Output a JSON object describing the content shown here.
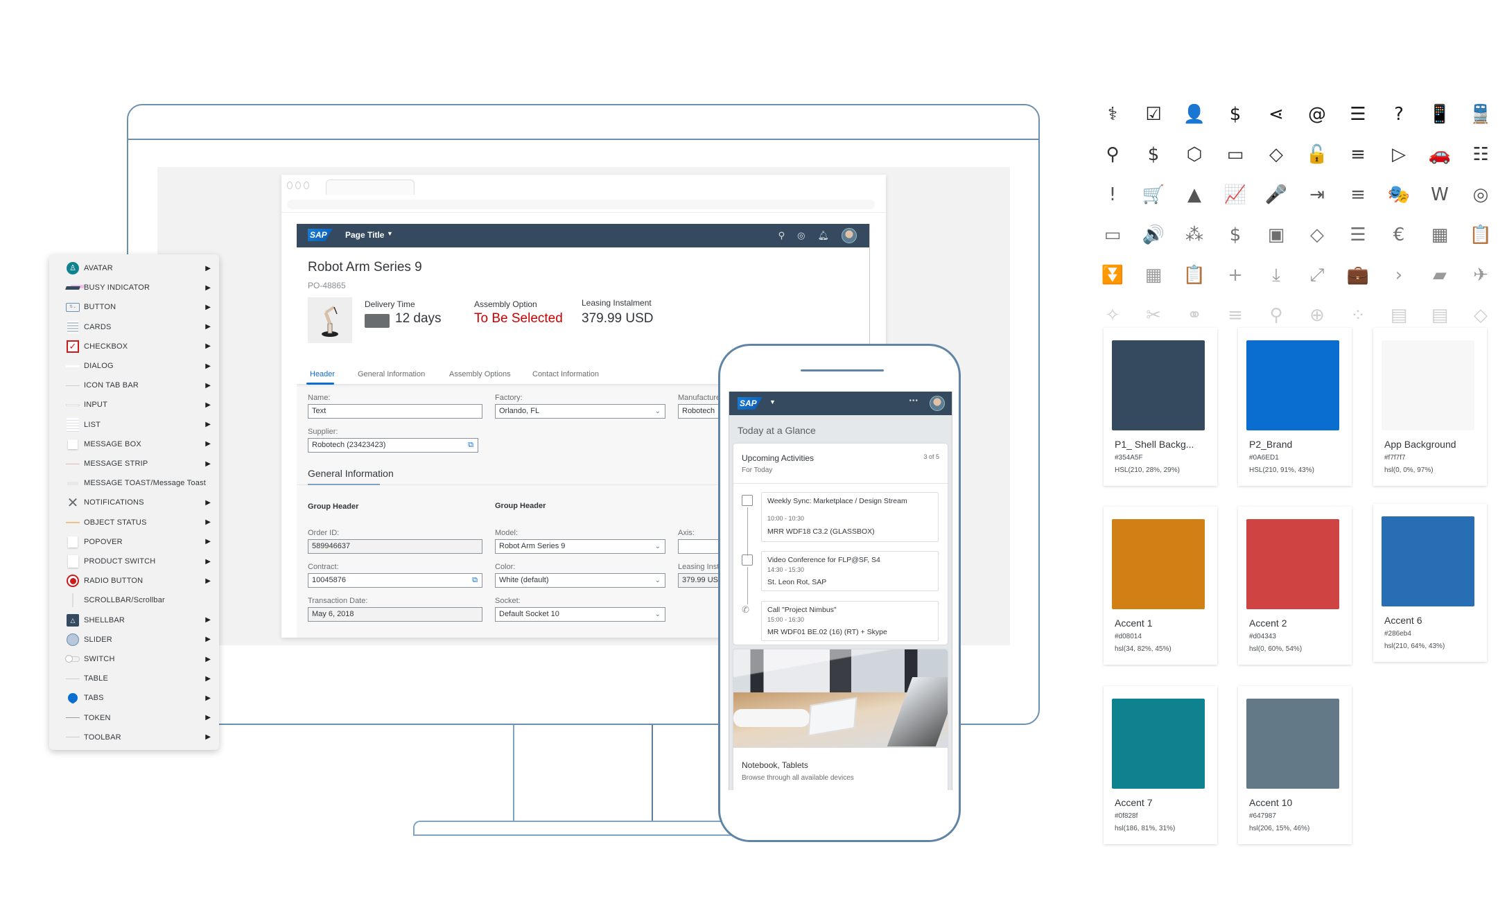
{
  "desktop_app": {
    "shellbar": {
      "logo": "SAP",
      "page_title": "Page Title"
    },
    "object": {
      "title": "Robot Arm Series 9",
      "subtitle": "PO-48865",
      "kpis": [
        {
          "label": "Delivery Time",
          "value": "12 days"
        },
        {
          "label": "Assembly Option",
          "value": "To Be Selected"
        },
        {
          "label": "Leasing Instalment",
          "value": "379.99 USD"
        }
      ]
    },
    "tabs": [
      "Header",
      "General Information",
      "Assembly Options",
      "Contact Information"
    ],
    "header_form": {
      "name": {
        "label": "Name:",
        "value": "Text"
      },
      "factory": {
        "label": "Factory:",
        "value": "Orlando, FL"
      },
      "manufacturer": {
        "label": "Manufacture",
        "value": "Robotech"
      },
      "supplier": {
        "label": "Supplier:",
        "value": "Robotech (23423423)"
      }
    },
    "general_section": {
      "title": "General Information",
      "group1": "Group Header",
      "group2": "Group Header",
      "order_id": {
        "label": "Order ID:",
        "value": "589946637"
      },
      "contract": {
        "label": "Contract:",
        "value": "10045876"
      },
      "transaction_date": {
        "label": "Transaction Date:",
        "value": "May 6, 2018"
      },
      "model": {
        "label": "Model:",
        "value": "Robot Arm Series 9"
      },
      "color": {
        "label": "Color:",
        "value": "White (default)"
      },
      "socket": {
        "label": "Socket:",
        "value": "Default Socket 10"
      },
      "axis": {
        "label": "Axis:",
        "value": ""
      },
      "leasing": {
        "label": "Leasing Inst",
        "value": "379.99 US"
      }
    }
  },
  "component_menu": {
    "items": [
      {
        "label": "AVATAR",
        "icon": "avatar-icon",
        "submenu": true
      },
      {
        "label": "BUSY INDICATOR",
        "icon": "busy-indicator-icon",
        "submenu": true
      },
      {
        "label": "BUTTON",
        "icon": "button-icon",
        "submenu": true
      },
      {
        "label": "CARDS",
        "icon": "cards-icon",
        "submenu": true
      },
      {
        "label": "CHECKBOX",
        "icon": "checkbox-icon",
        "submenu": true
      },
      {
        "label": "DIALOG",
        "icon": "dialog-icon",
        "submenu": true
      },
      {
        "label": "ICON TAB BAR",
        "icon": "icon-tab-bar-icon",
        "submenu": true
      },
      {
        "label": "INPUT",
        "icon": "input-icon",
        "submenu": true
      },
      {
        "label": "LIST",
        "icon": "list-icon",
        "submenu": true
      },
      {
        "label": "MESSAGE BOX",
        "icon": "message-box-icon",
        "submenu": true
      },
      {
        "label": "MESSAGE STRIP",
        "icon": "message-strip-icon",
        "submenu": true
      },
      {
        "label": "MESSAGE TOAST/Message Toast",
        "icon": "message-toast-icon",
        "submenu": false
      },
      {
        "label": "NOTIFICATIONS",
        "icon": "close-x-icon",
        "submenu": true
      },
      {
        "label": "OBJECT STATUS",
        "icon": "object-status-icon",
        "submenu": true
      },
      {
        "label": "POPOVER",
        "icon": "popover-icon",
        "submenu": true
      },
      {
        "label": "PRODUCT SWITCH",
        "icon": "product-switch-icon",
        "submenu": true
      },
      {
        "label": "RADIO BUTTON",
        "icon": "radio-button-icon",
        "submenu": true
      },
      {
        "label": "SCROLLBAR/Scrollbar",
        "icon": "scrollbar-icon",
        "submenu": false
      },
      {
        "label": "SHELLBAR",
        "icon": "shellbar-bell-icon",
        "submenu": true
      },
      {
        "label": "SLIDER",
        "icon": "slider-icon",
        "submenu": true
      },
      {
        "label": "SWITCH",
        "icon": "switch-icon",
        "submenu": true
      },
      {
        "label": "TABLE",
        "icon": "table-icon",
        "submenu": true
      },
      {
        "label": "TABS",
        "icon": "tabs-icon",
        "submenu": true
      },
      {
        "label": "TOKEN",
        "icon": "token-icon",
        "submenu": true
      },
      {
        "label": "TOOLBAR",
        "icon": "toolbar-icon",
        "submenu": true
      }
    ],
    "arrow": "▶"
  },
  "phone_app": {
    "logo": "SAP",
    "heading": "Today at a Glance",
    "activities_card": {
      "title": "Upcoming Activities",
      "subtitle": "For Today",
      "counter": "3 of 5",
      "items": [
        {
          "icon": "calendar-icon",
          "title": "Weekly Sync: Marketplace / Design Stream",
          "time": "10:00 - 10:30",
          "location": "MRR WDF18 C3.2 (GLASSBOX)"
        },
        {
          "icon": "video-conference-icon",
          "title": "Video Conference for FLP@SF, S4",
          "time": "14:30 - 15:30",
          "location": "St. Leon Rot, SAP"
        },
        {
          "icon": "phone-call-icon",
          "title": "Call \"Project Nimbus\"",
          "time": "15:00 - 16:30",
          "location": "MR WDF01 BE.02 (16) (RT) + Skype"
        }
      ]
    },
    "image_card": {
      "title": "Notebook, Tablets",
      "subtitle": "Browse through all available devices"
    }
  },
  "icon_grid": {
    "rows": [
      [
        "medicine-bottle-icon",
        "checkbox-checked-icon",
        "user-approved-icon",
        "document-dollar-icon",
        "share-icon",
        "user-email-icon",
        "gantt-bars-icon",
        "help-icon",
        "mobile-sync-icon",
        "train-icon"
      ],
      [
        "search-icon",
        "invoice-dollar-icon",
        "cluster-icon",
        "id-card-icon",
        "warning-diamond-icon",
        "user-unlocked-icon",
        "menu-hamburger-icon",
        "video-camera-icon",
        "car-crash-icon",
        "add-list-icon"
      ],
      [
        "alert-icon",
        "cart-approved-icon",
        "image-viewer-icon",
        "report-chart-icon",
        "microphone-icon",
        "import-icon",
        "filter-lines-icon",
        "theater-masks-icon",
        "word-doc-icon",
        "circle-outline-icon"
      ],
      [
        "window-icon",
        "speaker-icon",
        "network-nodes-icon",
        "money-coin-icon",
        "folder-full-icon",
        "tag-icon",
        "horizontal-bar-chart-icon",
        "calendar-euro-icon",
        "multi-charts-icon",
        "clipboard-icon"
      ],
      [
        "download-filter-icon",
        "dashboard-tiles-icon",
        "clipboard-user-icon",
        "add-document-icon",
        "download-tray-icon",
        "expand-icon",
        "money-folder-icon",
        "chevron-right-icon",
        "shape-parallelogram-icon",
        "travel-expense-icon"
      ],
      [
        "light-wand-icon",
        "tools-cancel-icon",
        "binoculars-add-icon",
        "lines-icon",
        "map-pin-icon",
        "web-page-icon",
        "scatter-icon",
        "contact-card-icon",
        "add-contact-icon",
        "diamond-outline-icon"
      ]
    ]
  },
  "color_swatches": [
    {
      "name": "P1_ Shell Backg...",
      "hex": "#354A5F",
      "hsl": "HSL(210, 28%, 29%)",
      "color": "#354a5f"
    },
    {
      "name": "P2_Brand",
      "hex": "#0A6ED1",
      "hsl": "HSL(210, 91%, 43%)",
      "color": "#0a6ed1"
    },
    {
      "name": "App Background",
      "hex": "#f7f7f7",
      "hsl": "hsl(0, 0%, 97%)",
      "color": "#f7f7f7"
    },
    {
      "name": "Accent 1",
      "hex": "#d08014",
      "hsl": "hsl(34, 82%, 45%)",
      "color": "#d08014"
    },
    {
      "name": "Accent 2",
      "hex": "#d04343",
      "hsl": "hsl(0, 60%, 54%)",
      "color": "#d04343"
    },
    {
      "name": "Accent 6",
      "hex": "#286eb4",
      "hsl": "hsl(210, 64%, 43%)",
      "color": "#286eb4"
    },
    {
      "name": "Accent 7",
      "hex": "#0f828f",
      "hsl": "hsl(186, 81%, 31%)",
      "color": "#0f828f"
    },
    {
      "name": "Accent 10",
      "hex": "#647987",
      "hsl": "hsl(206, 15%, 46%)",
      "color": "#647987"
    }
  ],
  "colors": {
    "shell": "#354a5f",
    "brand": "#0a6ed1",
    "negative": "#cc0000",
    "device_outline": "#6d8fae"
  }
}
